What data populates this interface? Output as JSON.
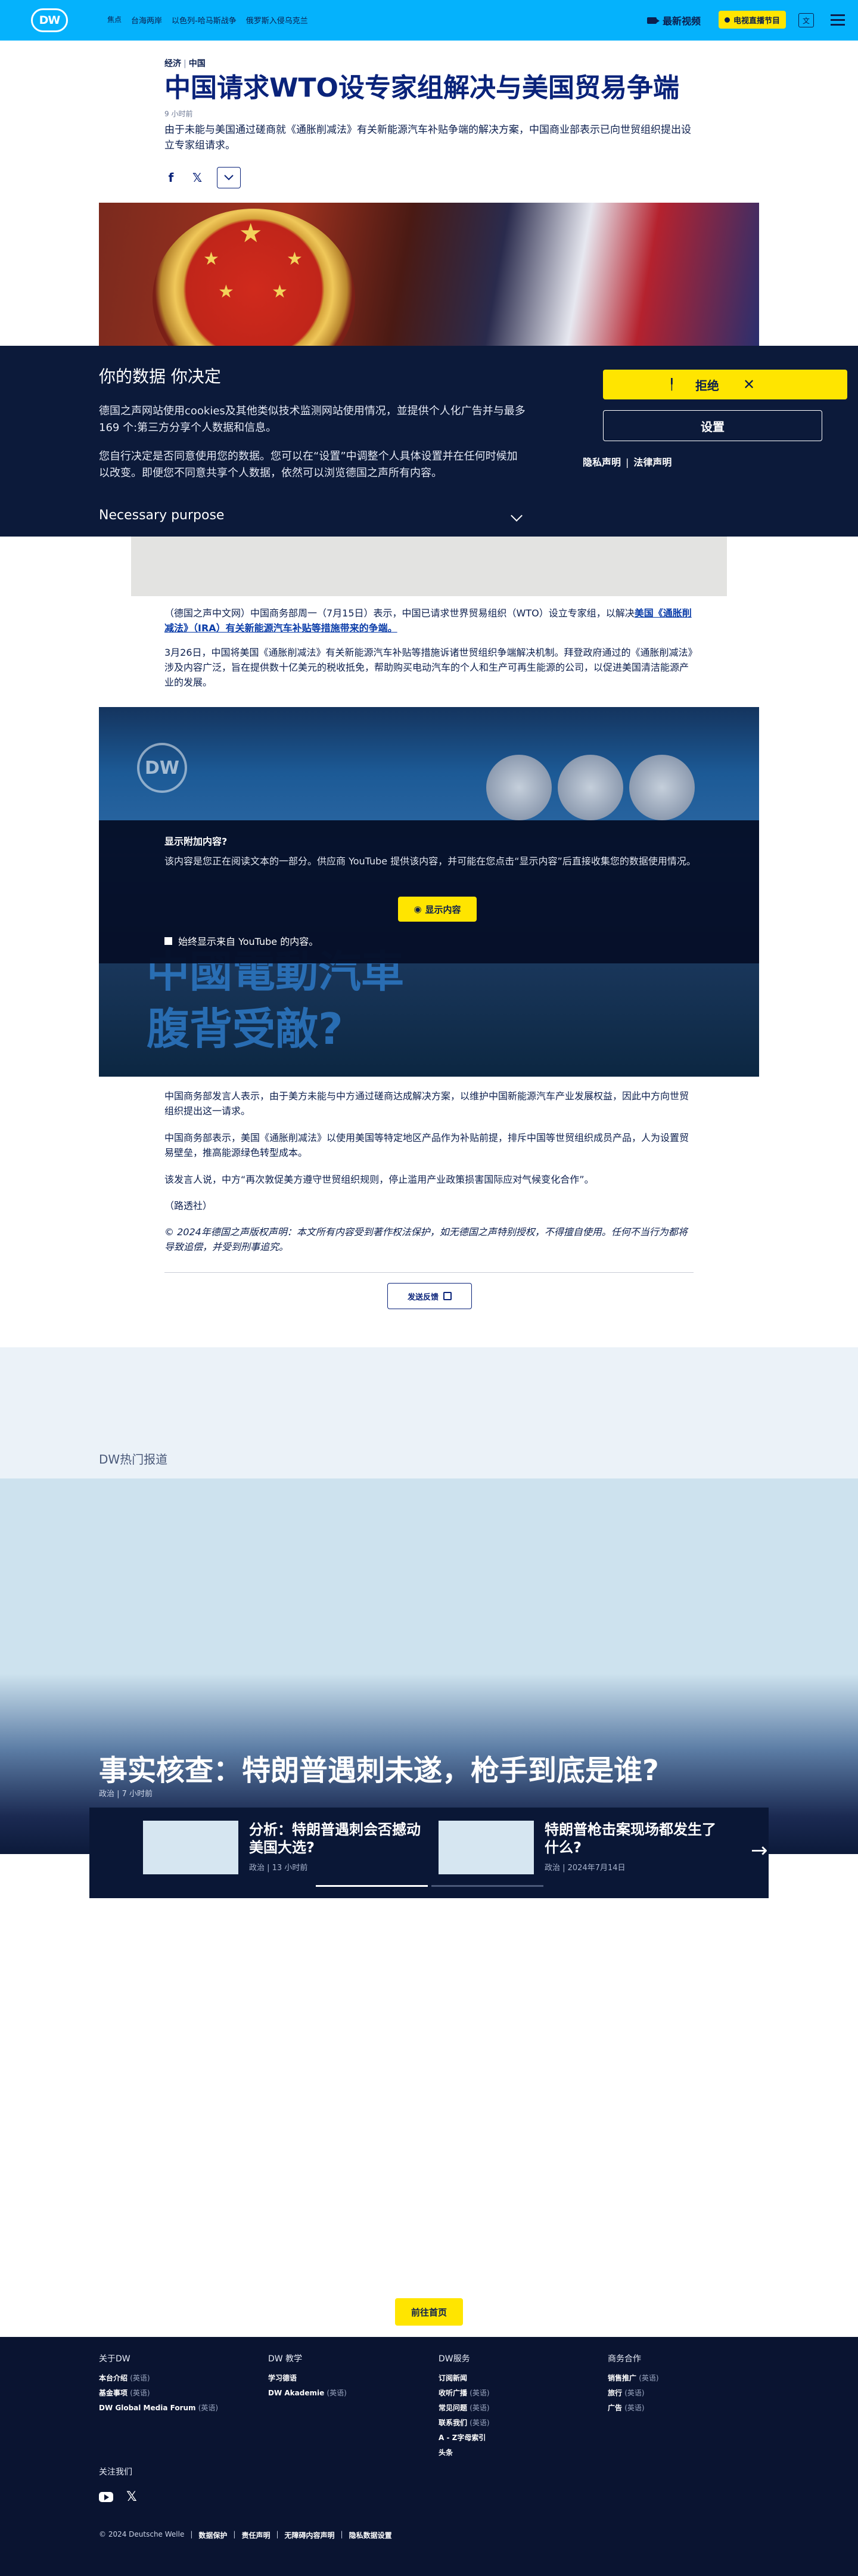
{
  "header": {
    "logo": "DW",
    "nav": [
      "焦点",
      "台海两岸",
      "以色列-哈马斯战争",
      "俄罗斯入侵乌克兰"
    ],
    "latest_video": "最新视频",
    "live_tv": "电视直播节目",
    "lang_label": "文"
  },
  "article": {
    "kicker_section": "经济",
    "kicker_region": "中国",
    "title": "中国请求WTO设专家组解决与美国贸易争端",
    "time": "9 小时前",
    "lead": "由于未能与美国通过磋商就《通胀削减法》有关新能源汽车补贴争端的解决方案，中国商业部表示已向世贸组织提出设立专家组请求。",
    "share_icons": [
      "facebook-icon",
      "x-icon",
      "chevron-down-icon"
    ],
    "para1_a": "（德国之声中文网）中国商务部周一（7月15日）表示，中国已请求世界贸易组织（WTO）设立专家组，以解决",
    "para1_link": "美国《通胀削减法》（IRA）有关新能源汽车补贴等措施带来的争端。",
    "para2": "3月26日，中国将美国《通胀削减法》有关新能源汽车补贴等措施诉诸世贸组织争端解决机制。拜登政府通过的《通胀削减法》涉及内容广泛，旨在提供数十亿美元的税收抵免，帮助购买电动汽车的个人和生产可再生能源的公司，以促进美国清洁能源产业的发展。",
    "para3": "中国商务部发言人表示，由于美方未能与中方通过磋商达成解决方案，以维护中国新能源汽车产业发展权益，因此中方向世贸组织提出这一请求。",
    "para4": "中国商务部表示，美国《通胀削减法》以使用美国等特定地区产品作为补贴前提，排斥中国等世贸组织成员产品，人为设置贸易壁垒，推高能源绿色转型成本。",
    "para5": "该发言人说，中方“再次敦促美方遵守世贸组织规则，停止滥用产业政策损害国际应对气候变化合作”。",
    "para6": "（路透社）",
    "copyright": "© 2024年德国之声版权声明：本文所有内容受到著作权法保护，如无德国之声特别授权，不得擅自使用。任何不当行为都将导致追偿，并受到刑事追究。",
    "feedback": "发送反馈"
  },
  "consent": {
    "title": "你的数据 你决定",
    "p1": "德国之声网站使用cookies及其他类似技术监测网站使用情况，並提供个人化广告并与最多169 个:第三方分享个人数据和信息。",
    "p2": "您自行决定是否同意使用您的数据。您可以在“设置”中调整个人具体设置并在任何时候加以改变。即便您不同意共享个人数据，依然可以浏览德国之声所有内容。",
    "purpose": "Necessary purpose",
    "reject": "拒绝",
    "settings": "设置",
    "privacy": "隐私声明",
    "legal": "法律声明"
  },
  "video": {
    "title_line1": "中國電動汽車",
    "title_line2": "腹背受敵?",
    "logo": "DW",
    "question": "显示附加内容?",
    "desc": "该内容是您正在阅读文本的一部分。供应商 YouTube 提供该内容，并可能在您点击“显示内容”后直接收集您的数据使用情况。",
    "show": "显示内容",
    "always": "始终显示来自 YouTube 的内容。"
  },
  "trending": {
    "section": "DW热门报道",
    "headline": "事实核查：特朗普遇刺未遂，枪手到底是谁?",
    "headline_meta": "政治 | 7 小时前",
    "cards": [
      {
        "title": "分析：特朗普遇刺会否撼动美国大选?",
        "meta": "政治 | 13 小时前"
      },
      {
        "title": "特朗普枪击案现场都发生了什么?",
        "meta": "政治 | 2024年7月14日"
      }
    ],
    "home": "前往首页"
  },
  "footer": {
    "cols": [
      {
        "title": "关于DW",
        "items": [
          [
            "本台介绍",
            "(英语)"
          ],
          [
            "基金事项",
            "(英语)"
          ],
          [
            "DW Global Media Forum",
            "(英语)"
          ]
        ]
      },
      {
        "title": "DW 教学",
        "items": [
          [
            "学习德语",
            ""
          ],
          [
            "DW Akademie",
            "(英语)"
          ]
        ]
      },
      {
        "title": "DW服务",
        "items": [
          [
            "订阅新闻",
            ""
          ],
          [
            "收听广播",
            "(英语)"
          ],
          [
            "常见问题",
            "(英语)"
          ],
          [
            "联系我们",
            "(英语)"
          ],
          [
            "A - Z字母索引",
            ""
          ],
          [
            "头条",
            ""
          ]
        ]
      },
      {
        "title": "商务合作",
        "items": [
          [
            "销售推广",
            "(英语)"
          ],
          [
            "旅行",
            "(英语)"
          ],
          [
            "广告",
            "(英语)"
          ]
        ]
      }
    ],
    "follow": "关注我们",
    "copyright": "© 2024 Deutsche Welle",
    "links": [
      "数据保护",
      "责任声明",
      "无障碍内容声明",
      "隐私数据设置"
    ]
  },
  "colors": {
    "brand_blue": "#05b2fc",
    "accent_yellow": "#ffe500",
    "navy": "#0a1431"
  }
}
